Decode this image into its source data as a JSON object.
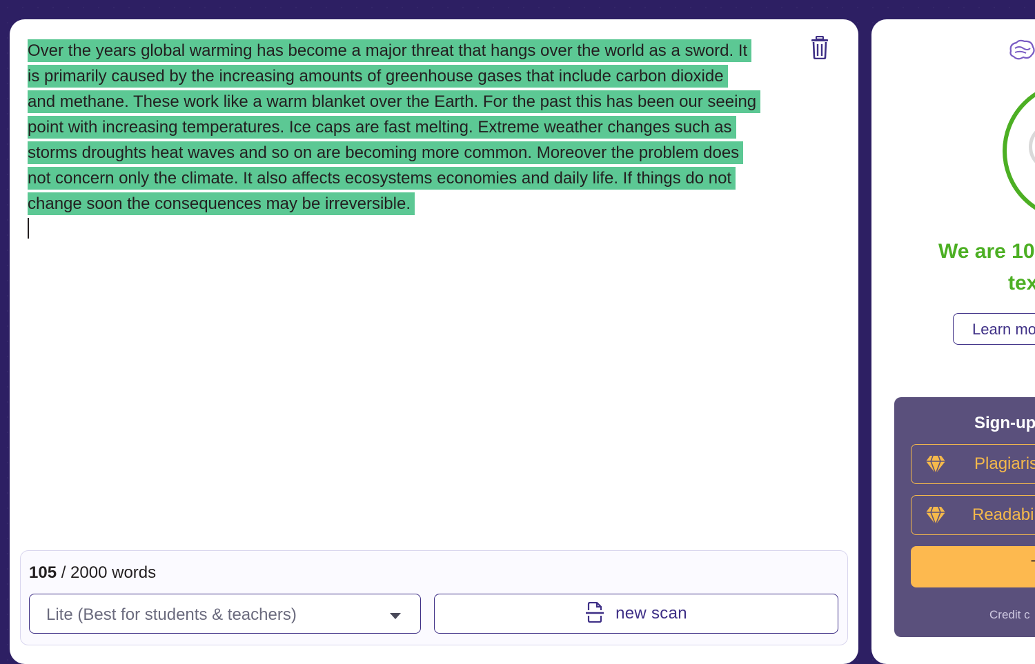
{
  "editor": {
    "lines": [
      "Over the years global warming has become a major threat that hangs over the world as a sword. It",
      "is primarily caused by the increasing amounts of greenhouse gases that include carbon dioxide",
      "and methane. These work like a warm blanket over the Earth. For the past this has been our seeing",
      "point with increasing temperatures. Ice caps are fast melting. Extreme weather changes such as",
      "storms droughts heat waves and so on are becoming more common. Moreover the problem does",
      "not concern only the climate. It also affects ecosystems economies and daily life. If things do not",
      "change soon the consequences may be irreversible."
    ],
    "highlight_color": "#5cc894",
    "delete_icon": "trash-icon"
  },
  "footer": {
    "word_count": "105",
    "word_limit_text": " / 2000 words",
    "mode_value": "Lite (Best for students & teachers)",
    "scan_label": "new scan",
    "scan_icon": "scan-document-icon"
  },
  "result": {
    "headline_line1": "We are 10",
    "headline_line2": "tex",
    "result_color": "#4caf23",
    "learn_label": "Learn mo",
    "brain_icon": "brain-icon"
  },
  "signup": {
    "title": "Sign-up",
    "features": [
      "Plagiaris",
      "Readabi"
    ],
    "feature_icon": "diamond-icon",
    "cta_label": "T",
    "credit_text": "Credit c"
  }
}
